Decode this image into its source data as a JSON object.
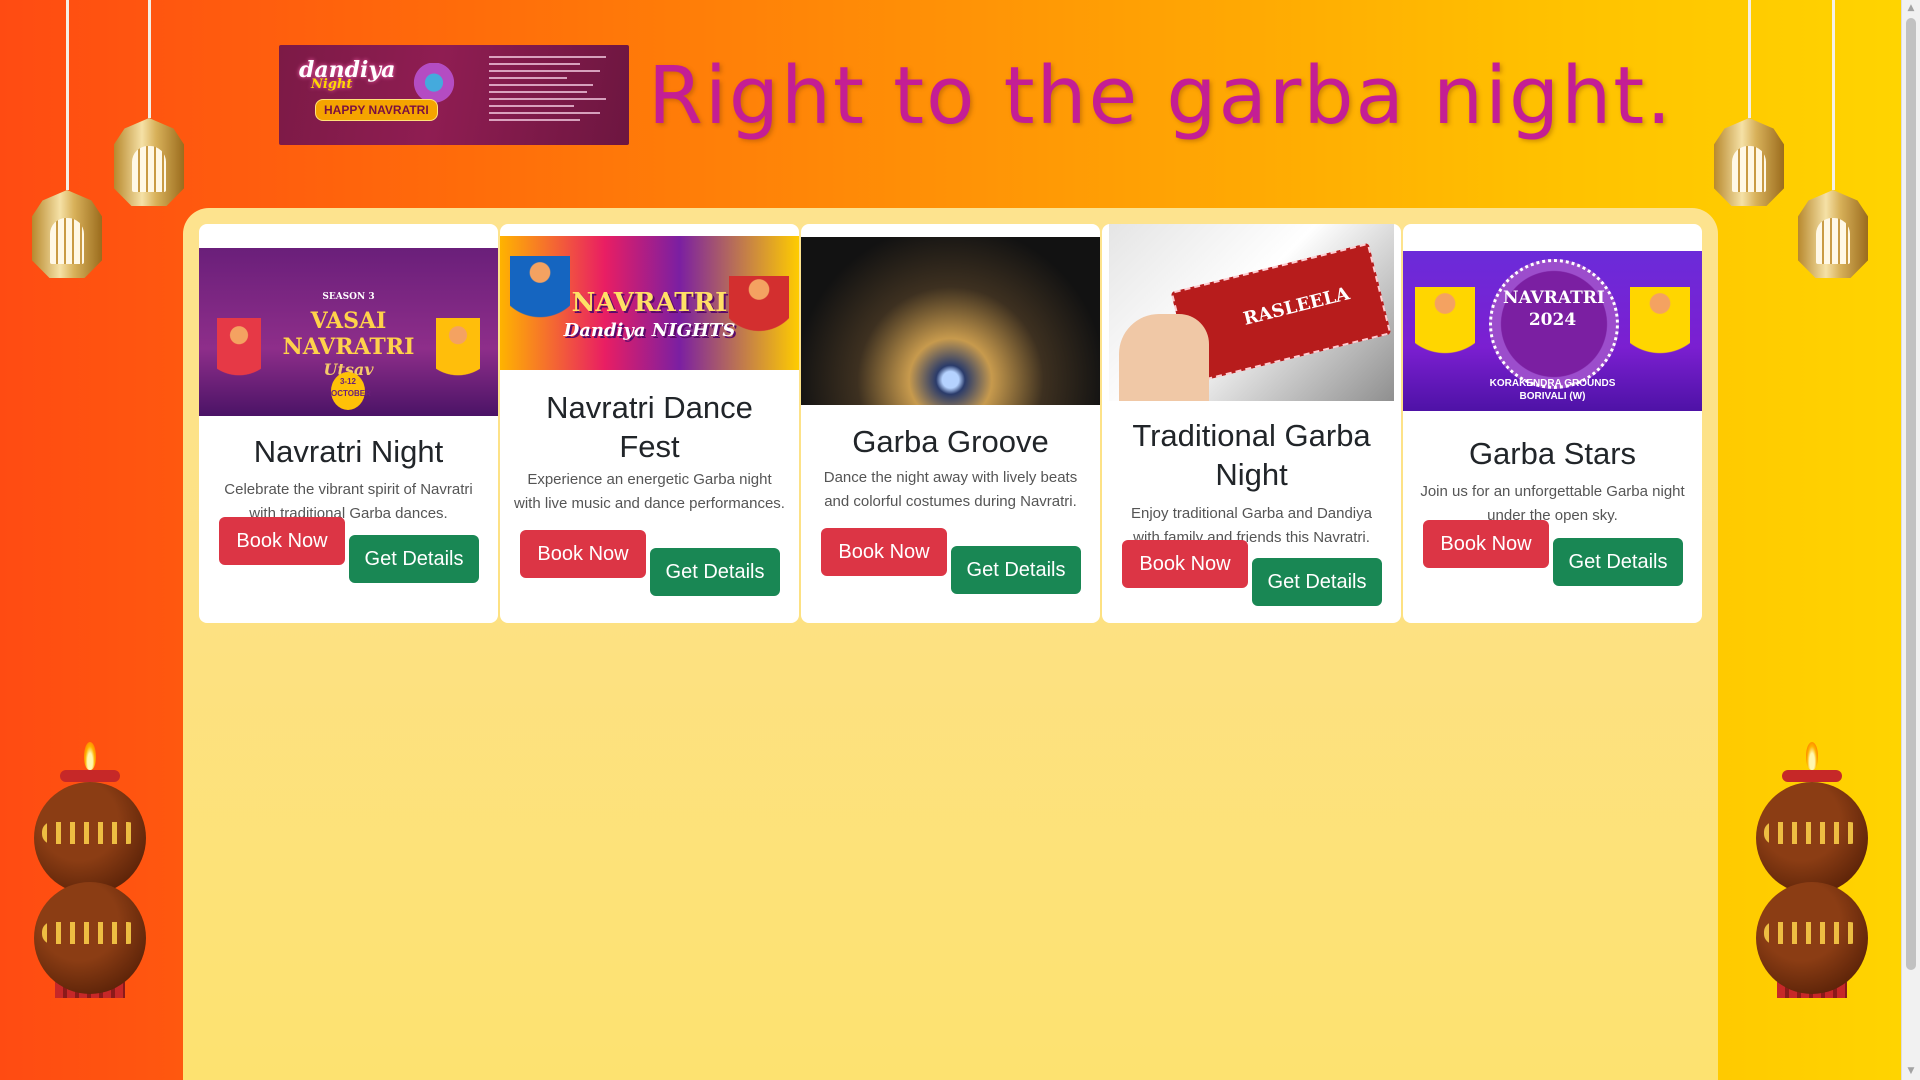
{
  "header": {
    "headline": "Right to the garba night.",
    "banner": {
      "logo_text": "dandiya",
      "logo_sub": "Night",
      "tag": "HAPPY NAVRATRI"
    }
  },
  "cards": [
    {
      "title": "Navratri Night",
      "text": "Celebrate the vibrant spirit of Navratri with traditional Garba dances.",
      "book_label": "Book Now",
      "details_label": "Get Details",
      "image_caption_main": "VASAI NAVRATRI",
      "image_caption_sub": "Utsav",
      "image_badge": "3-12 OCTOBER",
      "image_season": "SEASON 3"
    },
    {
      "title": "Navratri Dance Fest",
      "text": "Experience an energetic Garba night with live music and dance performances.",
      "book_label": "Book Now",
      "details_label": "Get Details",
      "image_caption_main": "NAVRATRI",
      "image_caption_sub": "Dandiya NIGHTS"
    },
    {
      "title": "Garba Groove",
      "text": "Dance the night away with lively beats and colorful costumes during Navratri.",
      "book_label": "Book Now",
      "details_label": "Get Details"
    },
    {
      "title": "Traditional Garba Night",
      "text": "Enjoy traditional Garba and Dandiya with family and friends this Navratri.",
      "book_label": "Book Now",
      "details_label": "Get Details",
      "image_caption_main": "RASLEELA"
    },
    {
      "title": "Garba Stars",
      "text": "Join us for an unforgettable Garba night under the open sky.",
      "book_label": "Book Now",
      "details_label": "Get Details",
      "image_caption_main": "NAVRATRI 2024",
      "image_caption_sub": "KORAKENDRA GROUNDS BORIVALI (W)"
    }
  ],
  "colors": {
    "headline": "#c41e94",
    "book_button": "#dc3545",
    "details_button": "#198754",
    "container": "#fde38e"
  },
  "icons": {
    "lamp": "hanging-lantern-icon",
    "diya": "diya-pot-icon"
  }
}
